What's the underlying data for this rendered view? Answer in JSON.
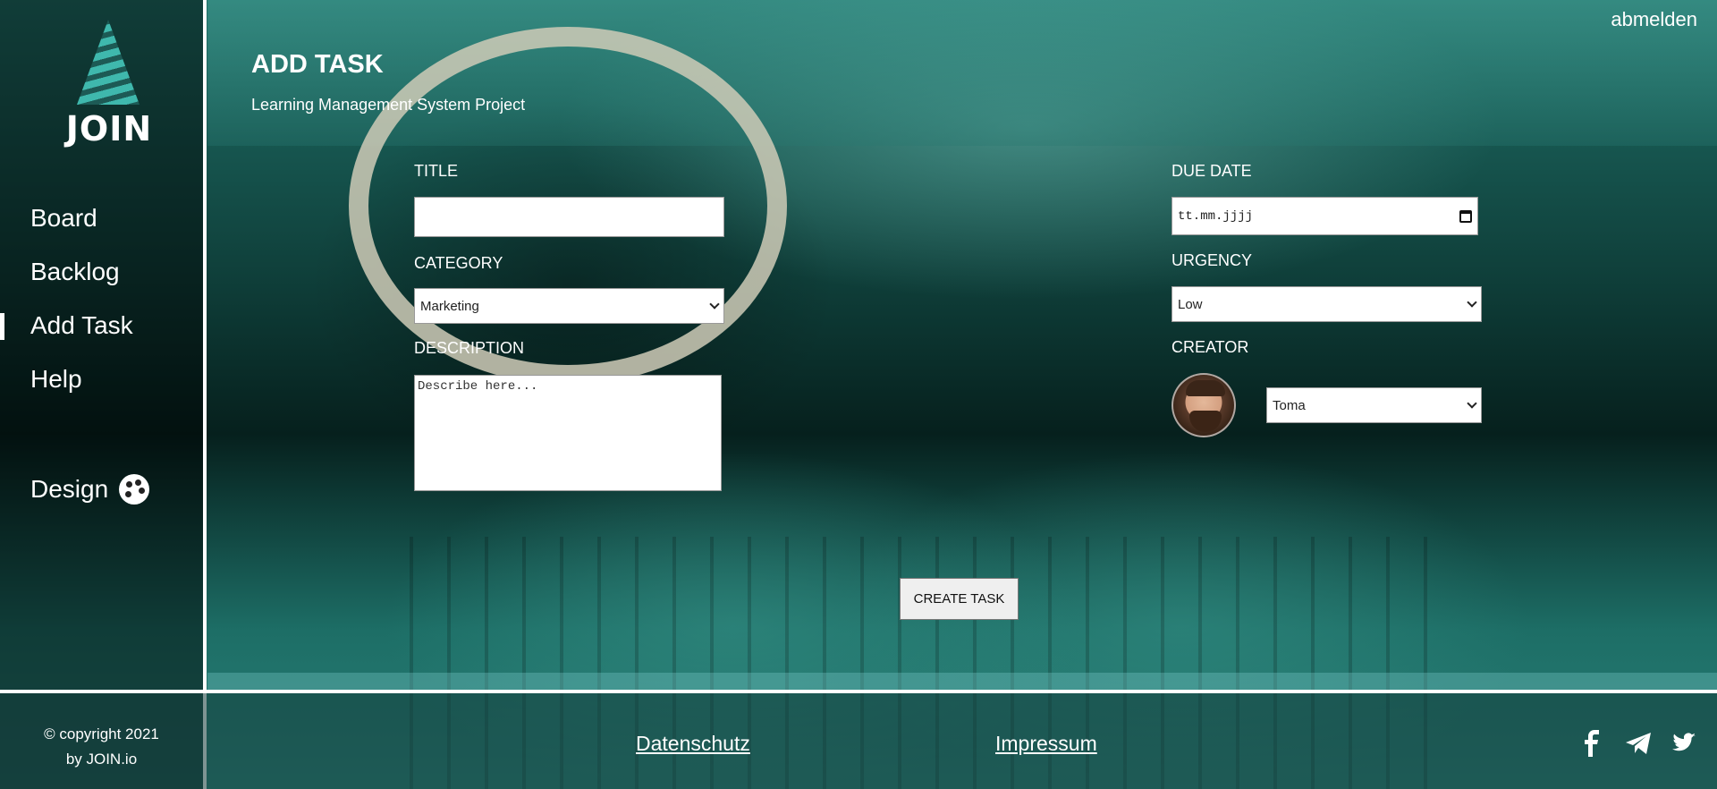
{
  "header": {
    "logout_label": "abmelden",
    "page_title": "ADD TASK",
    "page_subtitle": "Learning Management System Project"
  },
  "sidebar": {
    "logo_text": "JOIN",
    "items": [
      {
        "label": "Board",
        "active": false
      },
      {
        "label": "Backlog",
        "active": false
      },
      {
        "label": "Add Task",
        "active": true
      },
      {
        "label": "Help",
        "active": false
      }
    ],
    "design_label": "Design",
    "design_icon": "palette-icon"
  },
  "form": {
    "title_label": "TITLE",
    "title_value": "",
    "category_label": "CATEGORY",
    "category_value": "Marketing",
    "description_label": "DESCRIPTION",
    "description_placeholder": "Describe here...",
    "due_date_label": "DUE DATE",
    "due_date_placeholder": "tt.mm.jjjj",
    "urgency_label": "URGENCY",
    "urgency_value": "Low",
    "creator_label": "CREATOR",
    "creator_value": "Toma",
    "create_button_label": "CREATE TASK"
  },
  "footer": {
    "copyright_line1": "© copyright 2021",
    "copyright_line2": "by JOIN.io",
    "privacy_link": "Datenschutz",
    "imprint_link": "Impressum",
    "social_icons": [
      "facebook-icon",
      "telegram-icon",
      "twitter-icon"
    ]
  },
  "colors": {
    "accent": "#3fb8ad",
    "background_teal": "#1f6f67",
    "text": "#ffffff"
  }
}
